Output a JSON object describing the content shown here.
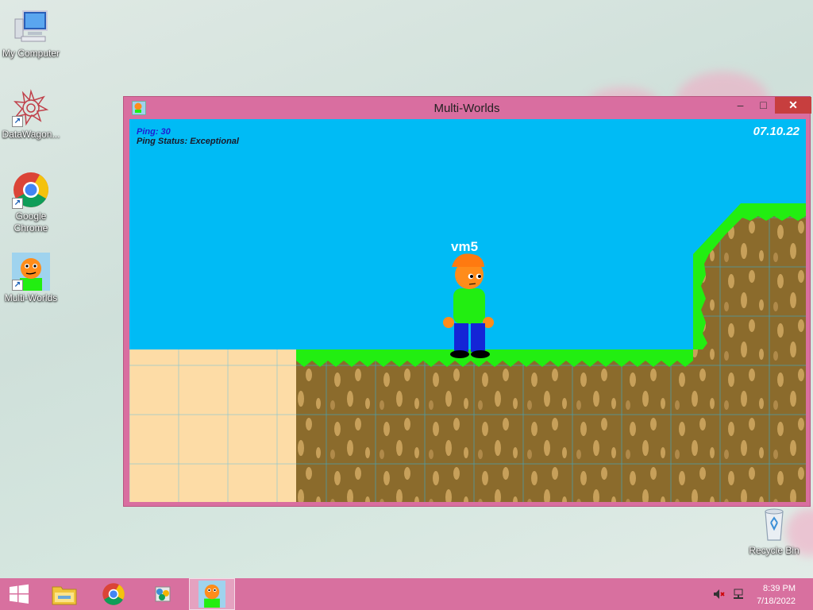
{
  "desktop": {
    "icons": [
      {
        "label": "My Computer",
        "icon": "computer-icon"
      },
      {
        "label": "DataWagon...",
        "icon": "datawagon-icon"
      },
      {
        "label": "Google Chrome",
        "icon": "chrome-icon"
      },
      {
        "label": "Multi-Worlds",
        "icon": "multiworlds-icon"
      },
      {
        "label": "Recycle Bin",
        "icon": "recycle-bin-icon"
      }
    ]
  },
  "window": {
    "title": "Multi-Worlds",
    "buttons": {
      "minimize": "–",
      "maximize": "□",
      "close": "✕"
    }
  },
  "game": {
    "ping": "Ping: 30",
    "ping_status": "Ping Status: Exceptional",
    "date": "07.10.22",
    "player_name": "vm5"
  },
  "taskbar": {
    "apps": [
      "start-icon",
      "file-explorer-icon",
      "chrome-icon",
      "datawagon-icon",
      "multiworlds-icon"
    ],
    "time": "8:39 PM",
    "date": "7/18/2022"
  },
  "colors": {
    "sky": "#00bbf5",
    "grass": "#22ee11",
    "dirt": "#8b6b2c",
    "sand": "#fddca6",
    "window_frame": "#d96ea0"
  }
}
